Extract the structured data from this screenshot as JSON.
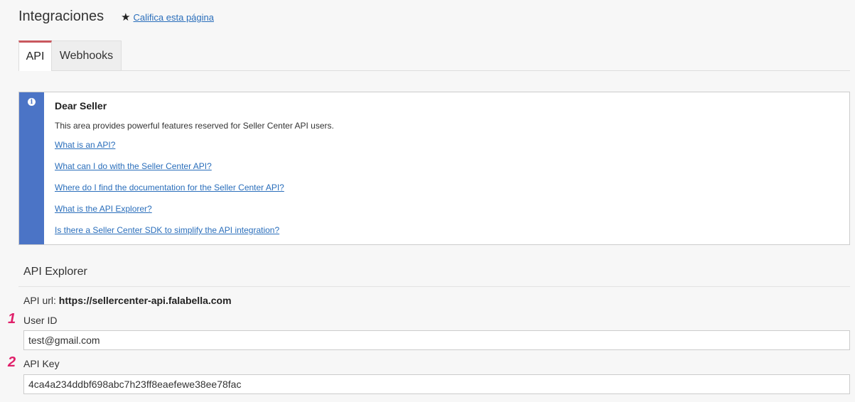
{
  "header": {
    "title": "Integraciones",
    "rate_label": "Califica esta página"
  },
  "tabs": [
    {
      "label": "API",
      "active": true
    },
    {
      "label": "Webhooks",
      "active": false
    }
  ],
  "info": {
    "title": "Dear Seller",
    "description": "This area provides powerful features reserved for Seller Center API users.",
    "links": [
      "What is an API?",
      "What can I do with the Seller Center API?",
      "Where do I find the documentation for the Seller Center API?",
      "What is the API Explorer?",
      "Is there a Seller Center SDK to simplify the API integration?"
    ]
  },
  "explorer": {
    "title": "API Explorer",
    "url_label": "API url:",
    "url_value": "https://sellercenter-api.falabella.com",
    "fields": [
      {
        "step": "1",
        "label": "User ID",
        "value": "test@gmail.com"
      },
      {
        "step": "2",
        "label": "API Key",
        "value": "4ca4a234ddbf698abc7h23ff8eaefewe38ee78fac"
      }
    ]
  },
  "colors": {
    "accent_tab": "#c9585e",
    "info_bar": "#4b74c6",
    "link": "#2a6ebb",
    "step_number": "#e0206a"
  }
}
